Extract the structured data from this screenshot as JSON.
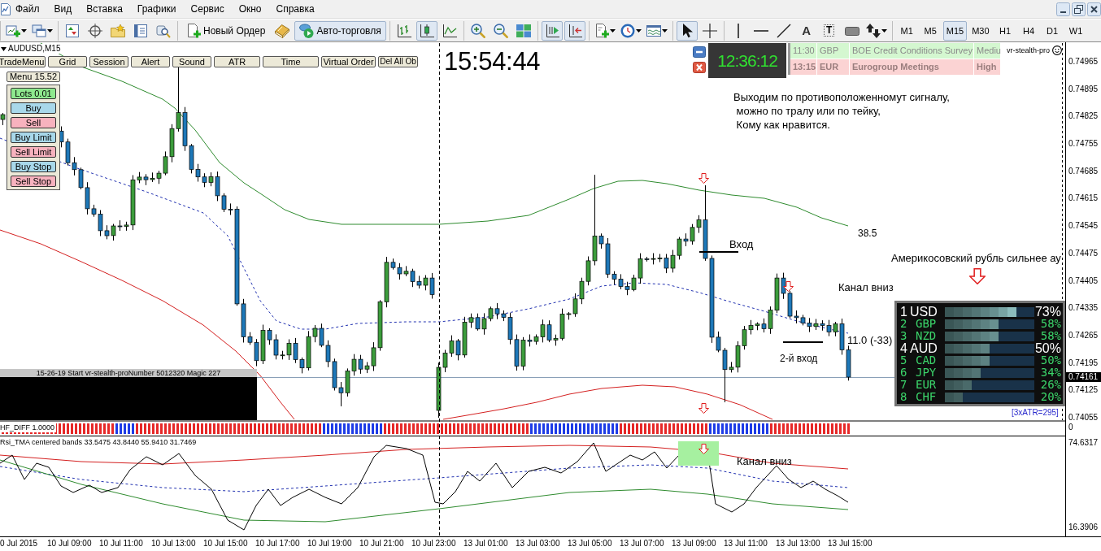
{
  "menu_bar": {
    "items": [
      "Файл",
      "Вид",
      "Вставка",
      "Графики",
      "Сервис",
      "Окно",
      "Справка"
    ]
  },
  "toolbar": {
    "groups": [
      [
        {
          "kind": "newchart",
          "menu": true,
          "pressed": false
        },
        {
          "kind": "profiles",
          "menu": true,
          "pressed": false
        }
      ],
      [
        {
          "kind": "marketwatch",
          "menu": false,
          "pressed": false
        },
        {
          "kind": "datawindow",
          "menu": false,
          "pressed": false
        },
        {
          "kind": "navigator",
          "menu": false,
          "pressed": false
        },
        {
          "kind": "terminal",
          "menu": false,
          "pressed": false
        },
        {
          "kind": "tester",
          "menu": false,
          "pressed": false
        }
      ],
      [
        {
          "kind": "neworder",
          "label": "Новый Ордер",
          "menu": false,
          "pressed": false
        },
        {
          "kind": "editor",
          "menu": false,
          "pressed": false
        },
        {
          "kind": "autotrading",
          "label": "Авто-торговля",
          "menu": false,
          "pressed": true
        }
      ],
      [
        {
          "kind": "bars",
          "menu": false,
          "pressed": false
        },
        {
          "kind": "candles",
          "menu": false,
          "pressed": true
        },
        {
          "kind": "line",
          "menu": false,
          "pressed": false
        }
      ],
      [
        {
          "kind": "zoomin",
          "menu": false,
          "pressed": false
        },
        {
          "kind": "zoomout",
          "menu": false,
          "pressed": false
        },
        {
          "kind": "tile",
          "menu": false,
          "pressed": false
        }
      ],
      [
        {
          "kind": "autoscroll",
          "menu": false,
          "pressed": true
        },
        {
          "kind": "chartshift",
          "menu": false,
          "pressed": true
        }
      ],
      [
        {
          "kind": "indicators",
          "menu": true,
          "pressed": false
        },
        {
          "kind": "periods",
          "menu": true,
          "pressed": false
        },
        {
          "kind": "templates",
          "menu": true,
          "pressed": false
        }
      ],
      [
        {
          "kind": "cursor",
          "menu": false,
          "pressed": true
        },
        {
          "kind": "crosshair",
          "menu": false,
          "pressed": false
        }
      ],
      [
        {
          "kind": "vline",
          "menu": false,
          "pressed": false
        },
        {
          "kind": "hline",
          "menu": false,
          "pressed": false
        },
        {
          "kind": "trendline",
          "menu": false,
          "pressed": false
        },
        {
          "kind": "text",
          "label": "A",
          "menu": false,
          "pressed": false
        },
        {
          "kind": "textlabel",
          "label": "T",
          "menu": false,
          "pressed": false
        },
        {
          "kind": "rectangle",
          "menu": false,
          "pressed": false
        },
        {
          "kind": "arrows",
          "menu": true,
          "pressed": false
        }
      ]
    ],
    "timeframes": [
      {
        "label": "M1",
        "selected": false
      },
      {
        "label": "M5",
        "selected": false
      },
      {
        "label": "M15",
        "selected": true
      },
      {
        "label": "M30",
        "selected": false
      },
      {
        "label": "H1",
        "selected": false
      },
      {
        "label": "H4",
        "selected": false
      },
      {
        "label": "D1",
        "selected": false
      },
      {
        "label": "W1",
        "selected": false
      }
    ]
  },
  "chart": {
    "symbol": "AUDUSD,M15",
    "panel_buttons": [
      "TradeMenu",
      "Grid",
      "Session",
      "Alert",
      "Sound",
      "ATR",
      "Time",
      "Virtual Order",
      "Del All Ob"
    ],
    "trade_menu": {
      "title": "Menu 15.52",
      "buttons": [
        {
          "label": "Lots 0.01",
          "color": "#8ee88e"
        },
        {
          "label": "Buy",
          "color": "#a8d8ea"
        },
        {
          "label": "Sell",
          "color": "#f7b2be"
        },
        {
          "label": "Buy Limit",
          "color": "#a8d8ea"
        },
        {
          "label": "Sell Limit",
          "color": "#f7b2be"
        },
        {
          "label": "Buy Stop",
          "color": "#a8d8ea"
        },
        {
          "label": "Sell Stop",
          "color": "#f7b2be"
        }
      ]
    },
    "clock": "15:54:44",
    "news": {
      "clock": "12:36:12",
      "events": [
        {
          "time": "11:30",
          "currency": "GBP",
          "title": "BOE Credit Conditions Survey",
          "impact": "Mediu",
          "color": "#d4f7d0",
          "bold": false
        },
        {
          "time": "13:15",
          "currency": "EUR",
          "title": "Eurogroup Meetings",
          "impact": "High",
          "color": "#fbd3d3",
          "bold": true
        }
      ]
    },
    "ea_name": "vr-stealth-pro",
    "ea_status": "15-26-19 Start vr-stealth-proNumber 5012320 Magic 227",
    "notes": [
      "Выходим по противоположенномут сигналу,\n можно по тралу или по тейку,\n Кому как нравится.",
      "Вход",
      "38.5",
      "Америкосовский рубль сильнее ау",
      "Канал вниз",
      "11.0 (-33)",
      "2-й вход"
    ],
    "strength": {
      "rows": [
        {
          "rank": "1",
          "currency": "USD",
          "level": 0.8,
          "percent": "73%",
          "highlighted": true
        },
        {
          "rank": "2",
          "currency": "GBP",
          "level": 0.6,
          "percent": "58%",
          "highlighted": false
        },
        {
          "rank": "3",
          "currency": "NZD",
          "level": 0.6,
          "percent": "58%",
          "highlighted": false
        },
        {
          "rank": "4",
          "currency": "AUD",
          "level": 0.5,
          "percent": "50%",
          "highlighted": true
        },
        {
          "rank": "5",
          "currency": "CAD",
          "level": 0.5,
          "percent": "50%",
          "highlighted": false
        },
        {
          "rank": "6",
          "currency": "JPY",
          "level": 0.4,
          "percent": "34%",
          "highlighted": false
        },
        {
          "rank": "7",
          "currency": "EUR",
          "level": 0.3,
          "percent": "26%",
          "highlighted": false
        },
        {
          "rank": "8",
          "currency": "CHF",
          "level": 0.2,
          "percent": "20%",
          "highlighted": false
        }
      ],
      "atr": "[3xATR=295]"
    },
    "price_axis": {
      "labels": [
        "0.74965",
        "0.74895",
        "0.74825",
        "0.74755",
        "0.74685",
        "0.74615",
        "0.74545",
        "0.74475",
        "0.74405",
        "0.74335",
        "0.74265",
        "0.74195",
        "0.74125",
        "0.74055"
      ],
      "current": "0.74161"
    },
    "indicators": [
      {
        "name": "HF_DIFF 1.0000",
        "axis": [
          "0"
        ]
      },
      {
        "name": "Rsi_TMA centered bands 33.5475 43.8440 55.9410 31.7469",
        "axis": [
          "74.6317",
          "16.3906"
        ],
        "notes": [
          "Канал вниз"
        ]
      }
    ],
    "time_axis": [
      "0 Jul 2015",
      "10 Jul 09:00",
      "10 Jul 11:00",
      "10 Jul 13:00",
      "10 Jul 15:00",
      "10 Jul 17:00",
      "10 Jul 19:00",
      "10 Jul 21:00",
      "10 Jul 23:00",
      "13 Jul 01:00",
      "13 Jul 03:00",
      "13 Jul 05:00",
      "13 Jul 07:00",
      "13 Jul 09:00",
      "13 Jul 11:00",
      "13 Jul 13:00",
      "13 Jul 15:00"
    ]
  }
}
